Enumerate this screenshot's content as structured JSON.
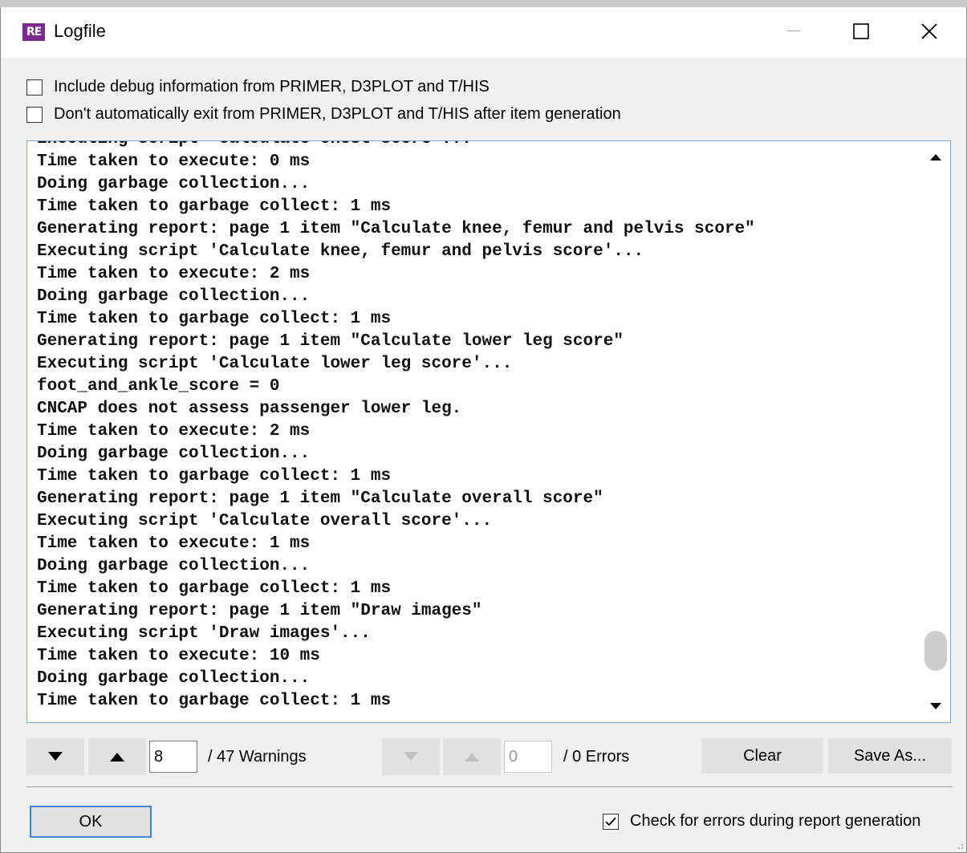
{
  "window": {
    "title": "Logfile",
    "app_icon_text": "RE"
  },
  "options": {
    "debug_label": "Include debug information from PRIMER, D3PLOT and T/HIS",
    "debug_checked": false,
    "noexit_label": "Don't automatically exit from PRIMER, D3PLOT and T/HIS after item generation",
    "noexit_checked": false
  },
  "log": {
    "lines": [
      "Executing script 'Calculate chest score'...",
      "Time taken to execute: 0 ms",
      "Doing garbage collection...",
      "Time taken to garbage collect: 1 ms",
      "Generating report: page 1 item \"Calculate knee, femur and pelvis score\"",
      "Executing script 'Calculate knee, femur and pelvis score'...",
      "Time taken to execute: 2 ms",
      "Doing garbage collection...",
      "Time taken to garbage collect: 1 ms",
      "Generating report: page 1 item \"Calculate lower leg score\"",
      "Executing script 'Calculate lower leg score'...",
      "foot_and_ankle_score = 0",
      "CNCAP does not assess passenger lower leg.",
      "Time taken to execute: 2 ms",
      "Doing garbage collection...",
      "Time taken to garbage collect: 1 ms",
      "Generating report: page 1 item \"Calculate overall score\"",
      "Executing script 'Calculate overall score'...",
      "Time taken to execute: 1 ms",
      "Doing garbage collection...",
      "Time taken to garbage collect: 1 ms",
      "Generating report: page 1 item \"Draw images\"",
      "Executing script 'Draw images'...",
      "Time taken to execute: 10 ms",
      "Doing garbage collection...",
      "Time taken to garbage collect: 1 ms"
    ]
  },
  "warnings": {
    "current": "8",
    "total_label": "/ 47 Warnings"
  },
  "errors": {
    "current": "0",
    "total_label": "/ 0 Errors"
  },
  "buttons": {
    "clear": "Clear",
    "save_as": "Save As...",
    "ok": "OK"
  },
  "footer": {
    "check_errors_label": "Check for errors during report generation",
    "check_errors_checked": true
  },
  "colors": {
    "accent": "#3c84d4",
    "app_icon": "#7a2a8c"
  }
}
